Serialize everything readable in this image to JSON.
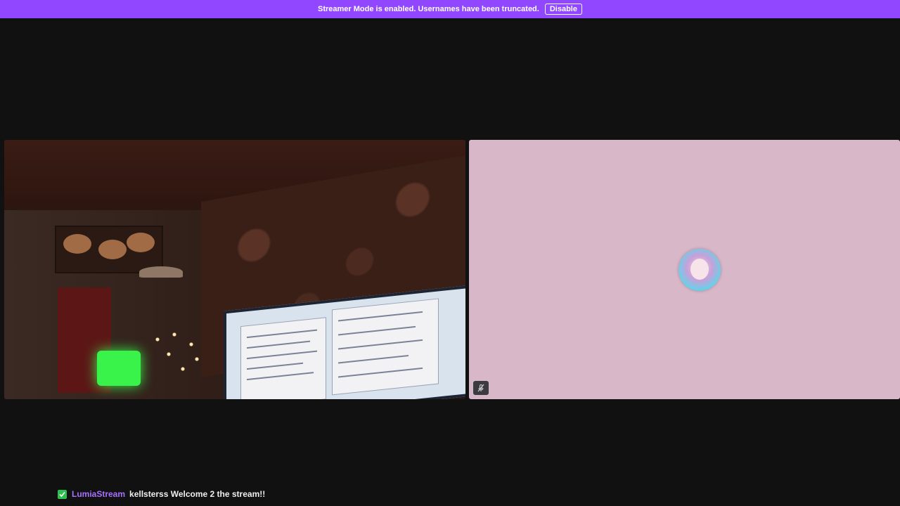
{
  "banner": {
    "text": "Streamer Mode is enabled. Usernames have been truncated.",
    "button_label": "Disable",
    "color": "#9147ff"
  },
  "tiles": {
    "camera": {
      "kind": "webcam-video"
    },
    "avatar": {
      "kind": "audio-only-participant",
      "background": "#d8b7c9",
      "mic_status": "muted",
      "mic_icon": "mic-off-icon"
    }
  },
  "chat": {
    "badge_icon": "verified-check-icon",
    "username": "LumiaStream",
    "username_color": "#a970ff",
    "message": "kellsterss Welcome 2 the stream!!"
  }
}
